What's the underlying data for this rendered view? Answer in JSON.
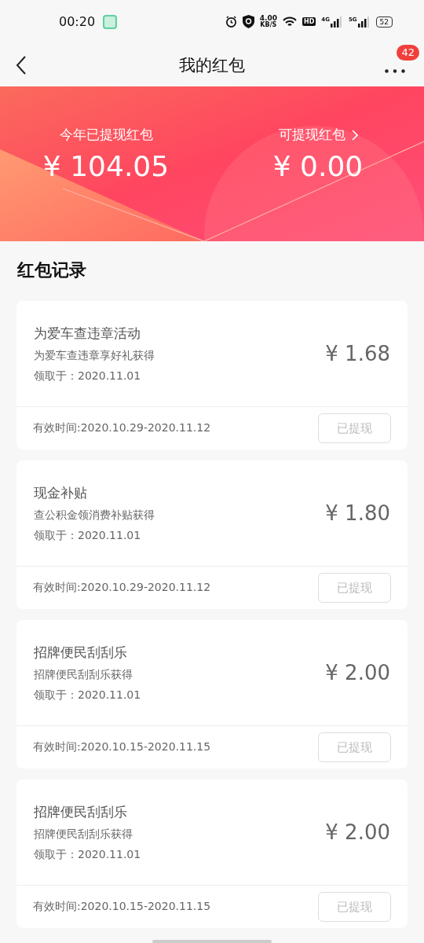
{
  "status_bar": {
    "time": "00:20",
    "speed_value": "4.00",
    "speed_unit": "KB/S",
    "hd": "HD",
    "net_4g": "4G",
    "net_5g": "5G",
    "battery": "52"
  },
  "nav": {
    "title": "我的红包",
    "badge": "42"
  },
  "banner": {
    "left": {
      "label": "今年已提现红包",
      "amount": "¥ 104.05"
    },
    "right": {
      "label": "可提现红包",
      "amount": "¥ 0.00"
    }
  },
  "section_title": "红包记录",
  "records": [
    {
      "title": "为爱车查违章活动",
      "source": "为爱车查违章享好礼获得",
      "received": "领取于：2020.11.01",
      "amount": "¥ 1.68",
      "validity": "有效时间:2020.10.29-2020.11.12",
      "button": "已提现",
      "disabled": true
    },
    {
      "title": "现金补贴",
      "source": "查公积金领消费补贴获得",
      "received": "领取于：2020.11.01",
      "amount": "¥ 1.80",
      "validity": "有效时间:2020.10.29-2020.11.12",
      "button": "已提现",
      "disabled": true
    },
    {
      "title": "招牌便民刮刮乐",
      "source": "招牌便民刮刮乐获得",
      "received": "领取于：2020.11.01",
      "amount": "¥ 2.00",
      "validity": "有效时间:2020.10.15-2020.11.15",
      "button": "已提现",
      "disabled": true
    },
    {
      "title": "招牌便民刮刮乐",
      "source": "招牌便民刮刮乐获得",
      "received": "领取于：2020.11.01",
      "amount": "¥ 2.00",
      "validity": "有效时间:2020.10.15-2020.11.15",
      "button": "已提现",
      "disabled": true
    }
  ]
}
